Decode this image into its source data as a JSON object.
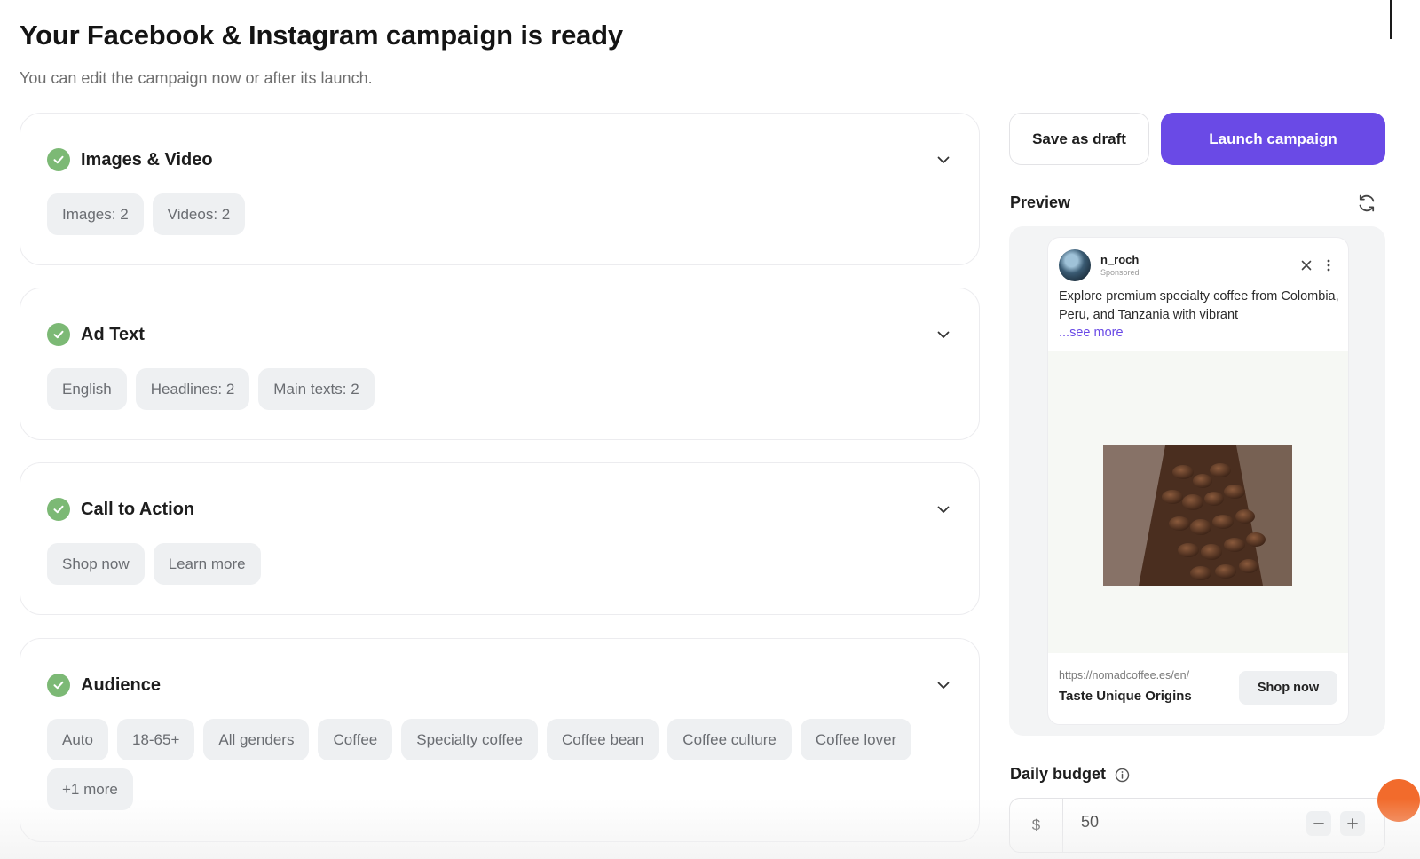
{
  "header": {
    "title": "Your Facebook & Instagram campaign is ready",
    "subtitle": "You can edit the campaign now or after its launch."
  },
  "sections": [
    {
      "title": "Images & Video",
      "status": "complete",
      "chips": [
        "Images: 2",
        "Videos: 2"
      ]
    },
    {
      "title": "Ad Text",
      "status": "complete",
      "chips": [
        "English",
        "Headlines: 2",
        "Main texts: 2"
      ]
    },
    {
      "title": "Call to Action",
      "status": "complete",
      "chips": [
        "Shop now",
        "Learn more"
      ]
    },
    {
      "title": "Audience",
      "status": "complete",
      "chips": [
        "Auto",
        "18-65+",
        "All genders",
        "Coffee",
        "Specialty coffee",
        "Coffee bean",
        "Coffee culture",
        "Coffee lover",
        "+1 more"
      ]
    }
  ],
  "actions": {
    "save_draft": "Save as draft",
    "launch": "Launch campaign"
  },
  "preview": {
    "label": "Preview",
    "ad": {
      "username": "n_roch",
      "sponsored": "Sponsored",
      "text": "Explore premium specialty coffee from Colombia, Peru, and Tanzania with vibrant",
      "see_more": "...see more",
      "url": "https://nomadcoffee.es/en/",
      "headline": "Taste Unique Origins",
      "cta": "Shop now"
    }
  },
  "budget": {
    "label": "Daily budget",
    "currency": "$",
    "value": "50"
  },
  "colors": {
    "accent": "#6a4ae6",
    "check": "#7cb975",
    "chip_bg": "#eef0f2"
  },
  "icons": [
    "check-icon",
    "chevron-down-icon",
    "refresh-icon",
    "close-icon",
    "more-vertical-icon",
    "info-icon",
    "minus-icon",
    "plus-icon"
  ]
}
